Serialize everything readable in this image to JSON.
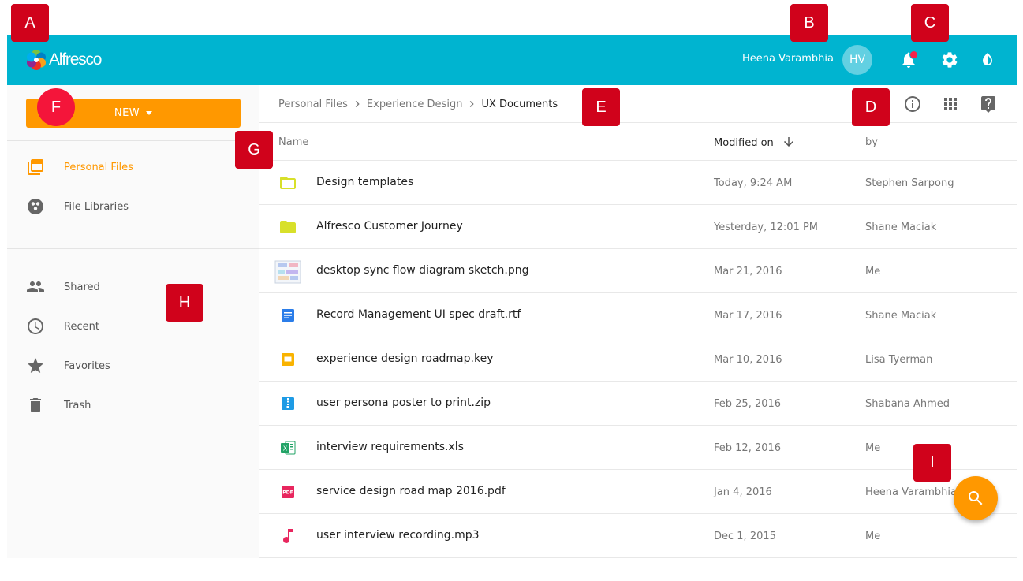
{
  "colors": {
    "header": "#00b4d0",
    "accent": "#ff9800",
    "callout": "#d0021b",
    "notification_dot": "#f5204a"
  },
  "header": {
    "logo_text": "Alfresco",
    "user_name": "Heena Varambhia",
    "avatar_initials": "HV",
    "icons": [
      "bell-icon",
      "gear-icon",
      "contrast-icon"
    ]
  },
  "sidebar": {
    "new_button": "NEW",
    "primary_items": [
      {
        "label": "Personal Files",
        "icon": "folder-stack-icon",
        "active": true
      },
      {
        "label": "File Libraries",
        "icon": "libraries-icon",
        "active": false
      }
    ],
    "secondary_items": [
      {
        "label": "Shared",
        "icon": "people-icon"
      },
      {
        "label": "Recent",
        "icon": "clock-icon"
      },
      {
        "label": "Favorites",
        "icon": "star-icon"
      },
      {
        "label": "Trash",
        "icon": "trash-icon"
      }
    ]
  },
  "breadcrumb": [
    "Personal Files",
    "Experience Design",
    "UX Documents"
  ],
  "toolbar_icons": [
    "info-icon",
    "grid-view-icon",
    "help-icon"
  ],
  "table": {
    "columns": {
      "name": "Name",
      "modified": "Modified on",
      "by": "by"
    },
    "rows": [
      {
        "name": "Design templates",
        "modified": "Today, 9:24 AM",
        "by": "Stephen Sarpong",
        "icon": "folder-outline-icon"
      },
      {
        "name": "Alfresco Customer Journey",
        "modified": "Yesterday, 12:01 PM",
        "by": "Shane Maciak",
        "icon": "folder-icon"
      },
      {
        "name": "desktop sync flow diagram sketch.png",
        "modified": "Mar 21, 2016",
        "by": "Me",
        "icon": "image-thumbnail-icon"
      },
      {
        "name": "Record Management UI spec draft.rtf",
        "modified": "Mar 17, 2016",
        "by": "Shane Maciak",
        "icon": "document-icon"
      },
      {
        "name": "experience design roadmap.key",
        "modified": "Mar 10, 2016",
        "by": "Lisa Tyerman",
        "icon": "presentation-icon"
      },
      {
        "name": "user persona poster to print.zip",
        "modified": "Feb 25, 2016",
        "by": "Shabana Ahmed",
        "icon": "zip-icon"
      },
      {
        "name": "interview requirements.xls",
        "modified": "Feb 12, 2016",
        "by": "Me",
        "icon": "spreadsheet-icon"
      },
      {
        "name": "service design road map 2016.pdf",
        "modified": "Jan 4, 2016",
        "by": "Heena Varambhia",
        "icon": "pdf-icon"
      },
      {
        "name": "user interview recording.mp3",
        "modified": "Dec 1, 2015",
        "by": "Me",
        "icon": "music-note-icon"
      }
    ]
  },
  "fab_icon": "search-icon",
  "callouts": [
    "A",
    "B",
    "C",
    "D",
    "E",
    "F",
    "G",
    "H",
    "I"
  ]
}
